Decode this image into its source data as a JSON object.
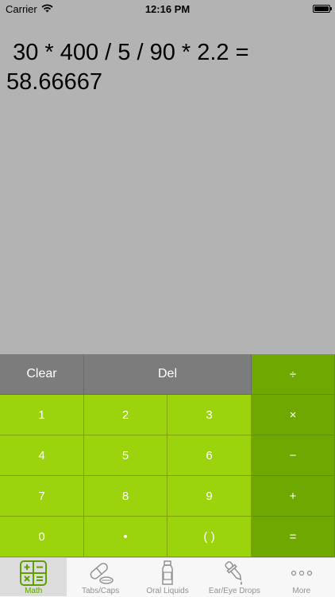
{
  "status_bar": {
    "carrier": "Carrier",
    "time": "12:16 PM",
    "wifi_icon": "wifi-icon",
    "battery_icon": "battery-icon"
  },
  "display": {
    "expression": " 30 * 400 / 5 / 90 * 2.2 = 58.66667"
  },
  "keypad": {
    "clear": "Clear",
    "del": "Del",
    "divide": "÷",
    "multiply": "×",
    "minus": "−",
    "plus": "+",
    "equals": "=",
    "k1": "1",
    "k2": "2",
    "k3": "3",
    "k4": "4",
    "k5": "5",
    "k6": "6",
    "k7": "7",
    "k8": "8",
    "k9": "9",
    "k0": "0",
    "dot": "•",
    "parens": "( )"
  },
  "tabs": [
    {
      "label": "Math",
      "icon": "calculator-icon",
      "active": true
    },
    {
      "label": "Tabs/Caps",
      "icon": "pills-icon",
      "active": false
    },
    {
      "label": "Oral Liquids",
      "icon": "bottle-icon",
      "active": false
    },
    {
      "label": "Ear/Eye Drops",
      "icon": "dropper-icon",
      "active": false
    },
    {
      "label": "More",
      "icon": "more-icon",
      "active": false
    }
  ],
  "colors": {
    "display_bg": "#b3b3b3",
    "num_key": "#9bd30d",
    "op_key": "#6fa800",
    "gray_key": "#7c7c7c",
    "active_tab": "#5fa000",
    "inactive_tab": "#929292"
  }
}
